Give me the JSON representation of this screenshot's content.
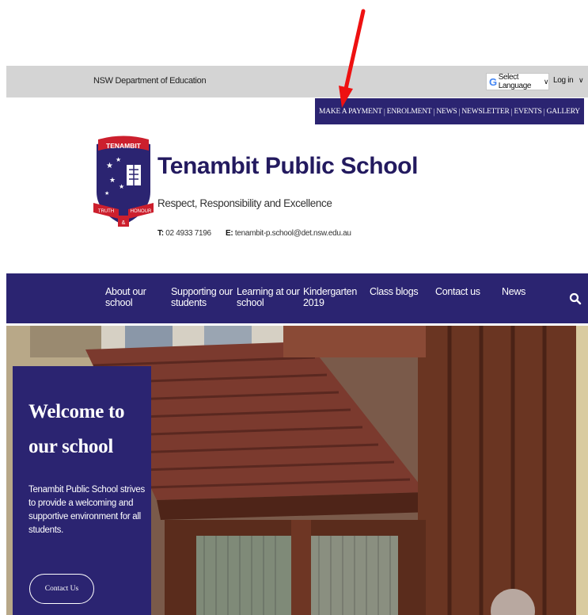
{
  "topbar": {
    "department": "NSW Department of Education",
    "language_select": "Select Language",
    "login": "Log in"
  },
  "quick_links": [
    "MAKE A PAYMENT",
    "ENROLMENT",
    "NEWS",
    "NEWSLETTER",
    "EVENTS",
    "GALLERY"
  ],
  "crest": {
    "banner": "TENAMBIT",
    "scroll_left": "TRUTH",
    "scroll_amp": "&",
    "scroll_right": "HONOUR"
  },
  "school": {
    "name": "Tenambit Public School",
    "tagline": "Respect, Responsibility and Excellence",
    "phone_label": "T:",
    "phone": "02 4933 7196",
    "email_label": "E:",
    "email": "tenambit-p.school@det.nsw.edu.au"
  },
  "main_nav": [
    {
      "line1": "About our",
      "line2": "school"
    },
    {
      "line1": "Supporting our",
      "line2": "students"
    },
    {
      "line1": "Learning at our",
      "line2": "school"
    },
    {
      "line1": "Kindergarten",
      "line2": "2019"
    },
    {
      "line1": "Class blogs",
      "line2": ""
    },
    {
      "line1": "Contact us",
      "line2": ""
    },
    {
      "line1": "News",
      "line2": ""
    }
  ],
  "welcome": {
    "title": "Welcome to our school",
    "text": "Tenambit Public School strives to provide a welcoming and supportive environment for all students.",
    "button": "Contact Us"
  },
  "icons": {
    "search": "search-icon",
    "arrow": "annotation-arrow-icon",
    "google": "google-g-icon",
    "dropdown": "chevron-down-icon"
  },
  "colors": {
    "brand_navy": "#2b2471",
    "title_navy": "#231a5f",
    "topbar_gray": "#d4d4d4",
    "arrow_red": "#ee1111",
    "crest_red": "#cc1f2d"
  }
}
